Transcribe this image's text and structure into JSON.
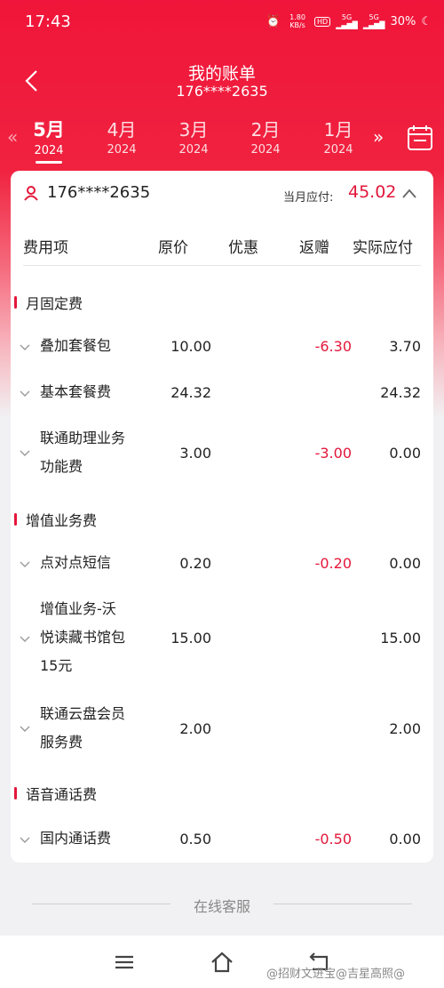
{
  "status_bar": {
    "time": "17:43",
    "net_speed": "1.80 KB/s",
    "hd": "HD",
    "sig1": "5G",
    "sig2": "5G",
    "battery": "30%"
  },
  "header": {
    "title": "我的账单",
    "subtitle": "176****2635"
  },
  "months": [
    {
      "month": "5月",
      "year": "2024",
      "active": true
    },
    {
      "month": "4月",
      "year": "2024",
      "active": false
    },
    {
      "month": "3月",
      "year": "2024",
      "active": false
    },
    {
      "month": "2月",
      "year": "2024",
      "active": false
    },
    {
      "month": "1月",
      "year": "2024",
      "active": false
    }
  ],
  "account": {
    "number": "176****2635",
    "due_label": "当月应付:",
    "due_value": "45.02"
  },
  "columns": {
    "item": "费用项",
    "original": "原价",
    "discount": "优惠",
    "rebate": "返赠",
    "actual": "实际应付"
  },
  "sections": {
    "fixed": {
      "title": "月固定费"
    },
    "value_added": {
      "title": "增值业务费"
    },
    "voice": {
      "title": "语音通话费"
    }
  },
  "items": [
    {
      "name": [
        "叠加套餐包"
      ],
      "original": "10.00",
      "rebate": "-6.30",
      "actual": "3.70"
    },
    {
      "name": [
        "基本套餐费"
      ],
      "original": "24.32",
      "rebate": "",
      "actual": "24.32"
    },
    {
      "name": [
        "联通助理业务",
        "功能费"
      ],
      "original": "3.00",
      "rebate": "-3.00",
      "actual": "0.00"
    },
    {
      "name": [
        "点对点短信"
      ],
      "original": "0.20",
      "rebate": "-0.20",
      "actual": "0.00"
    },
    {
      "name": [
        "增值业务-沃",
        "悦读藏书馆包",
        "15元"
      ],
      "original": "15.00",
      "rebate": "",
      "actual": "15.00"
    },
    {
      "name": [
        "联通云盘会员",
        "服务费"
      ],
      "original": "2.00",
      "rebate": "",
      "actual": "2.00"
    },
    {
      "name": [
        "国内通话费"
      ],
      "original": "0.50",
      "rebate": "-0.50",
      "actual": "0.00"
    }
  ],
  "footer": {
    "service": "在线客服"
  },
  "watermark": "@招财文进宝@吉星高照@",
  "colors": {
    "brand_red": "#f0153a",
    "rebate_red": "#e3163a"
  }
}
